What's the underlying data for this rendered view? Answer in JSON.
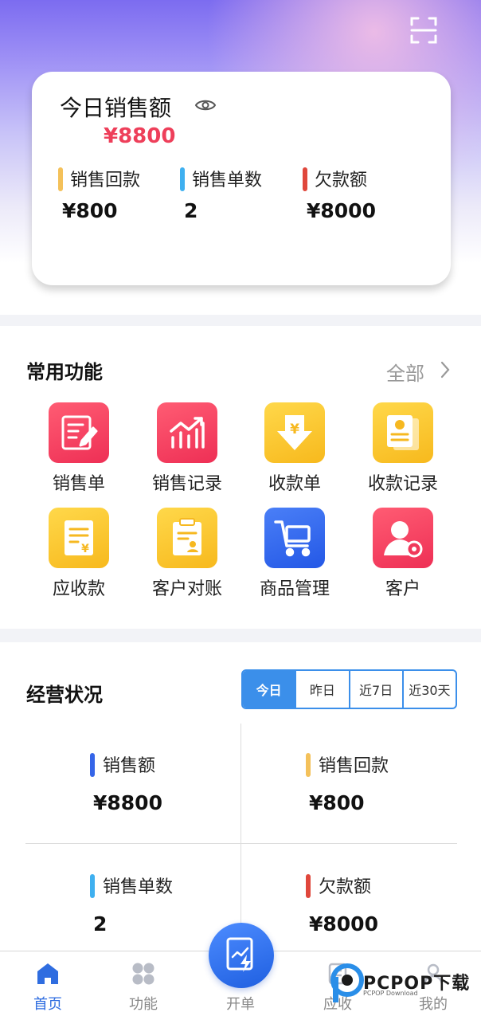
{
  "summary": {
    "title": "今日销售额",
    "amount": "¥8800",
    "stats": [
      {
        "label": "销售回款",
        "value": "¥800",
        "color": "#f4c15a"
      },
      {
        "label": "销售单数",
        "value": "2",
        "color": "#3fb0f0"
      },
      {
        "label": "欠款额",
        "value": "¥8000",
        "color": "#e0473c"
      }
    ]
  },
  "functions": {
    "title": "常用功能",
    "all_label": "全部",
    "items": [
      {
        "label": "销售单",
        "icon": "sales-order-icon"
      },
      {
        "label": "销售记录",
        "icon": "sales-record-icon"
      },
      {
        "label": "收款单",
        "icon": "receipt-icon"
      },
      {
        "label": "收款记录",
        "icon": "receipt-record-icon"
      },
      {
        "label": "应收款",
        "icon": "receivable-icon"
      },
      {
        "label": "客户对账",
        "icon": "reconciliation-icon"
      },
      {
        "label": "商品管理",
        "icon": "cart-icon"
      },
      {
        "label": "客户",
        "icon": "customer-icon"
      }
    ]
  },
  "business": {
    "title": "经营状况",
    "periods": [
      "今日",
      "昨日",
      "近7日",
      "近30天"
    ],
    "selected_period": "今日",
    "metrics": [
      {
        "label": "销售额",
        "value": "¥8800",
        "color": "#3565e8"
      },
      {
        "label": "销售回款",
        "value": "¥800",
        "color": "#f4c15a"
      },
      {
        "label": "销售单数",
        "value": "2",
        "color": "#3fb0f0"
      },
      {
        "label": "欠款额",
        "value": "¥8000",
        "color": "#e0473c"
      }
    ]
  },
  "tabs": [
    {
      "label": "首页",
      "icon": "home-icon",
      "active": true
    },
    {
      "label": "功能",
      "icon": "grid-icon",
      "active": false
    },
    {
      "label": "开单",
      "icon": "create-order-icon",
      "active": false
    },
    {
      "label": "应收",
      "icon": "receivable-tab-icon",
      "active": false
    },
    {
      "label": "我的",
      "icon": "profile-icon",
      "active": false
    }
  ],
  "watermark": {
    "brand": "PCPOP下载",
    "sub": "PCPOP Download"
  }
}
